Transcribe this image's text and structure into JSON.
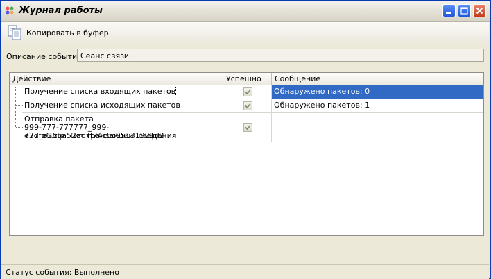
{
  "window": {
    "title": "Журнал работы"
  },
  "toolbar": {
    "copy_label": "Копировать в буфер"
  },
  "event": {
    "description_label": "Описание события",
    "description_value": "Сеанс связи"
  },
  "grid": {
    "columns": [
      "Действие",
      "Успешно",
      "Сообщение"
    ],
    "rows": [
      {
        "action": "Получение списка входящих пакетов",
        "success": true,
        "message": "Обнаружено пакетов: 0",
        "selected": true
      },
      {
        "action": "Получение списка исходящих пакетов",
        "success": true,
        "message": "Обнаружено пакетов: 1",
        "selected": false
      },
      {
        "action_lines": [
          "Отправка пакета",
          "999-777-777777_999-777_a36ba52ac7f74c5c95131921d2",
          "e3dfa6.zip. Тип транзакции: сведения"
        ],
        "success": true,
        "message": "",
        "selected": false
      }
    ]
  },
  "status": {
    "text": "Статус события:  Выполнено"
  },
  "colors": {
    "selection": "#316ac5",
    "title_bar": "#e4e1d6",
    "close_button": "#c4391b"
  }
}
